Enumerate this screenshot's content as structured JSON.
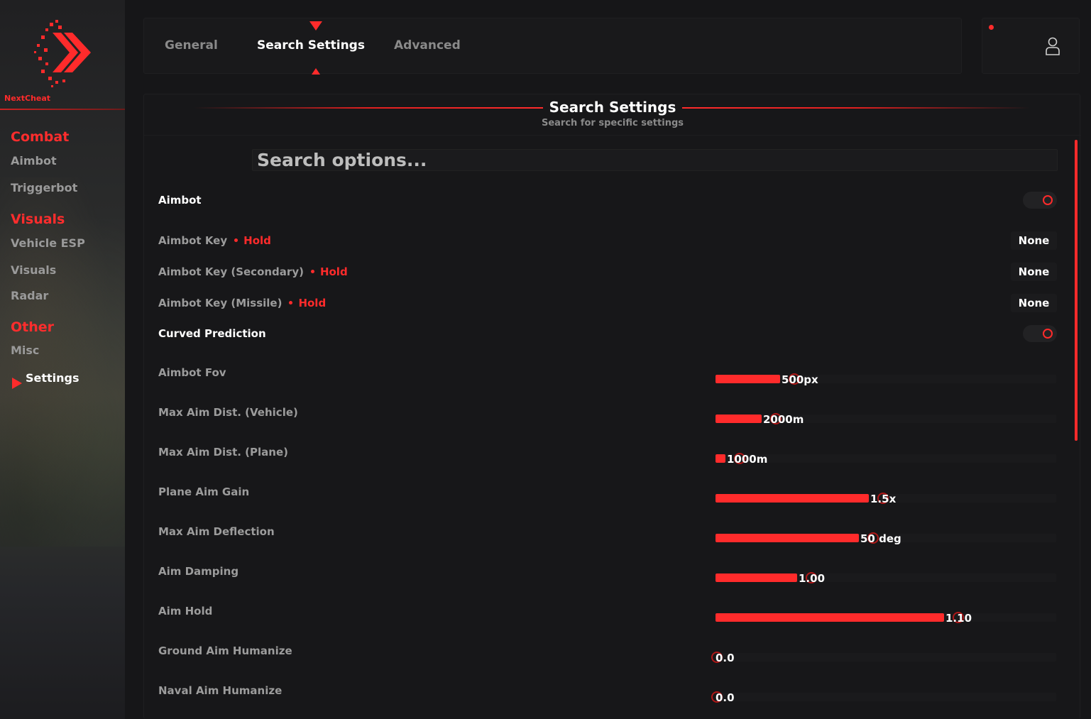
{
  "brand": {
    "name": "NextCheat"
  },
  "sidebar": {
    "categories": [
      {
        "label": "Combat",
        "items": [
          {
            "label": "Aimbot"
          },
          {
            "label": "Triggerbot"
          }
        ]
      },
      {
        "label": "Visuals",
        "items": [
          {
            "label": "Vehicle ESP"
          },
          {
            "label": "Visuals"
          },
          {
            "label": "Radar"
          }
        ]
      },
      {
        "label": "Other",
        "items": [
          {
            "label": "Misc"
          },
          {
            "label": "Settings",
            "active": true
          }
        ]
      }
    ]
  },
  "tabs": [
    {
      "label": "General"
    },
    {
      "label": "Search Settings",
      "active": true
    },
    {
      "label": "Advanced"
    }
  ],
  "header": {
    "user_icon": "user-icon",
    "status_dot_color": "#ff2b2b"
  },
  "panel": {
    "title": "Search Settings",
    "subtitle": "Search for specific settings",
    "search": {
      "placeholder": "Search options...",
      "value": ""
    }
  },
  "settings": {
    "aimbot": {
      "label": "Aimbot",
      "enabled": false
    },
    "keys": [
      {
        "label": "Aimbot Key",
        "mode": "Hold",
        "value": "None"
      },
      {
        "label": "Aimbot Key (Secondary)",
        "mode": "Hold",
        "value": "None"
      },
      {
        "label": "Aimbot Key (Missile)",
        "mode": "Hold",
        "value": "None"
      }
    ],
    "curved": {
      "label": "Curved Prediction",
      "enabled": false
    },
    "sliders": [
      {
        "label": "Aimbot Fov",
        "value": "500px",
        "fraction": 0.19
      },
      {
        "label": "Max Aim Dist. (Vehicle)",
        "value": "2000m",
        "fraction": 0.135
      },
      {
        "label": "Max Aim Dist. (Plane)",
        "value": "1000m",
        "fraction": 0.03
      },
      {
        "label": "Plane Aim Gain",
        "value": "1.5x",
        "fraction": 0.45
      },
      {
        "label": "Max Aim Deflection",
        "value": "50 deg",
        "fraction": 0.42
      },
      {
        "label": "Aim Damping",
        "value": "1.00",
        "fraction": 0.24
      },
      {
        "label": "Aim Hold",
        "value": "1.10",
        "fraction": 0.67
      },
      {
        "label": "Ground Aim Humanize",
        "value": "0.0",
        "fraction": 0.0
      },
      {
        "label": "Naval Aim Humanize",
        "value": "0.0",
        "fraction": 0.0
      }
    ]
  },
  "colors": {
    "accent": "#ff2b2b",
    "bg": "#161618",
    "panel": "#171719"
  }
}
